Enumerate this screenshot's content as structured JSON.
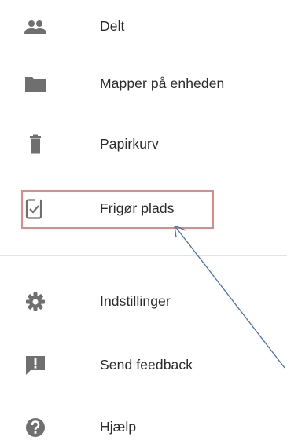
{
  "menu": {
    "items": [
      {
        "label": "Delt",
        "icon": "people-icon"
      },
      {
        "label": "Mapper på enheden",
        "icon": "folder-icon"
      },
      {
        "label": "Papirkurv",
        "icon": "trash-icon"
      },
      {
        "label": "Frigør plads",
        "icon": "free-space-icon"
      },
      {
        "label": "Indstillinger",
        "icon": "gear-icon"
      },
      {
        "label": "Send feedback",
        "icon": "feedback-icon"
      },
      {
        "label": "Hjælp",
        "icon": "help-icon"
      }
    ]
  },
  "colors": {
    "icon": "#6f6f6f",
    "text": "#2b2b2b",
    "highlight_border": "#d98a8a",
    "arrow": "#4a6fb0",
    "divider": "#e3e3e3"
  }
}
